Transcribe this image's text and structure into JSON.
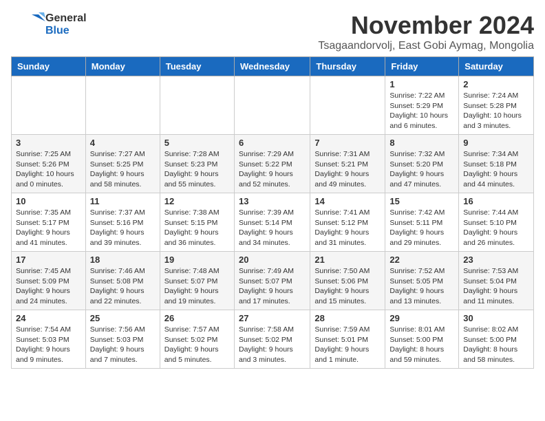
{
  "header": {
    "logo_general": "General",
    "logo_blue": "Blue",
    "month_title": "November 2024",
    "location": "Tsagaandorvolj, East Gobi Aymag, Mongolia"
  },
  "weekdays": [
    "Sunday",
    "Monday",
    "Tuesday",
    "Wednesday",
    "Thursday",
    "Friday",
    "Saturday"
  ],
  "weeks": [
    [
      {
        "day": "",
        "info": ""
      },
      {
        "day": "",
        "info": ""
      },
      {
        "day": "",
        "info": ""
      },
      {
        "day": "",
        "info": ""
      },
      {
        "day": "",
        "info": ""
      },
      {
        "day": "1",
        "info": "Sunrise: 7:22 AM\nSunset: 5:29 PM\nDaylight: 10 hours\nand 6 minutes."
      },
      {
        "day": "2",
        "info": "Sunrise: 7:24 AM\nSunset: 5:28 PM\nDaylight: 10 hours\nand 3 minutes."
      }
    ],
    [
      {
        "day": "3",
        "info": "Sunrise: 7:25 AM\nSunset: 5:26 PM\nDaylight: 10 hours\nand 0 minutes."
      },
      {
        "day": "4",
        "info": "Sunrise: 7:27 AM\nSunset: 5:25 PM\nDaylight: 9 hours\nand 58 minutes."
      },
      {
        "day": "5",
        "info": "Sunrise: 7:28 AM\nSunset: 5:23 PM\nDaylight: 9 hours\nand 55 minutes."
      },
      {
        "day": "6",
        "info": "Sunrise: 7:29 AM\nSunset: 5:22 PM\nDaylight: 9 hours\nand 52 minutes."
      },
      {
        "day": "7",
        "info": "Sunrise: 7:31 AM\nSunset: 5:21 PM\nDaylight: 9 hours\nand 49 minutes."
      },
      {
        "day": "8",
        "info": "Sunrise: 7:32 AM\nSunset: 5:20 PM\nDaylight: 9 hours\nand 47 minutes."
      },
      {
        "day": "9",
        "info": "Sunrise: 7:34 AM\nSunset: 5:18 PM\nDaylight: 9 hours\nand 44 minutes."
      }
    ],
    [
      {
        "day": "10",
        "info": "Sunrise: 7:35 AM\nSunset: 5:17 PM\nDaylight: 9 hours\nand 41 minutes."
      },
      {
        "day": "11",
        "info": "Sunrise: 7:37 AM\nSunset: 5:16 PM\nDaylight: 9 hours\nand 39 minutes."
      },
      {
        "day": "12",
        "info": "Sunrise: 7:38 AM\nSunset: 5:15 PM\nDaylight: 9 hours\nand 36 minutes."
      },
      {
        "day": "13",
        "info": "Sunrise: 7:39 AM\nSunset: 5:14 PM\nDaylight: 9 hours\nand 34 minutes."
      },
      {
        "day": "14",
        "info": "Sunrise: 7:41 AM\nSunset: 5:12 PM\nDaylight: 9 hours\nand 31 minutes."
      },
      {
        "day": "15",
        "info": "Sunrise: 7:42 AM\nSunset: 5:11 PM\nDaylight: 9 hours\nand 29 minutes."
      },
      {
        "day": "16",
        "info": "Sunrise: 7:44 AM\nSunset: 5:10 PM\nDaylight: 9 hours\nand 26 minutes."
      }
    ],
    [
      {
        "day": "17",
        "info": "Sunrise: 7:45 AM\nSunset: 5:09 PM\nDaylight: 9 hours\nand 24 minutes."
      },
      {
        "day": "18",
        "info": "Sunrise: 7:46 AM\nSunset: 5:08 PM\nDaylight: 9 hours\nand 22 minutes."
      },
      {
        "day": "19",
        "info": "Sunrise: 7:48 AM\nSunset: 5:07 PM\nDaylight: 9 hours\nand 19 minutes."
      },
      {
        "day": "20",
        "info": "Sunrise: 7:49 AM\nSunset: 5:07 PM\nDaylight: 9 hours\nand 17 minutes."
      },
      {
        "day": "21",
        "info": "Sunrise: 7:50 AM\nSunset: 5:06 PM\nDaylight: 9 hours\nand 15 minutes."
      },
      {
        "day": "22",
        "info": "Sunrise: 7:52 AM\nSunset: 5:05 PM\nDaylight: 9 hours\nand 13 minutes."
      },
      {
        "day": "23",
        "info": "Sunrise: 7:53 AM\nSunset: 5:04 PM\nDaylight: 9 hours\nand 11 minutes."
      }
    ],
    [
      {
        "day": "24",
        "info": "Sunrise: 7:54 AM\nSunset: 5:03 PM\nDaylight: 9 hours\nand 9 minutes."
      },
      {
        "day": "25",
        "info": "Sunrise: 7:56 AM\nSunset: 5:03 PM\nDaylight: 9 hours\nand 7 minutes."
      },
      {
        "day": "26",
        "info": "Sunrise: 7:57 AM\nSunset: 5:02 PM\nDaylight: 9 hours\nand 5 minutes."
      },
      {
        "day": "27",
        "info": "Sunrise: 7:58 AM\nSunset: 5:02 PM\nDaylight: 9 hours\nand 3 minutes."
      },
      {
        "day": "28",
        "info": "Sunrise: 7:59 AM\nSunset: 5:01 PM\nDaylight: 9 hours\nand 1 minute."
      },
      {
        "day": "29",
        "info": "Sunrise: 8:01 AM\nSunset: 5:00 PM\nDaylight: 8 hours\nand 59 minutes."
      },
      {
        "day": "30",
        "info": "Sunrise: 8:02 AM\nSunset: 5:00 PM\nDaylight: 8 hours\nand 58 minutes."
      }
    ]
  ]
}
